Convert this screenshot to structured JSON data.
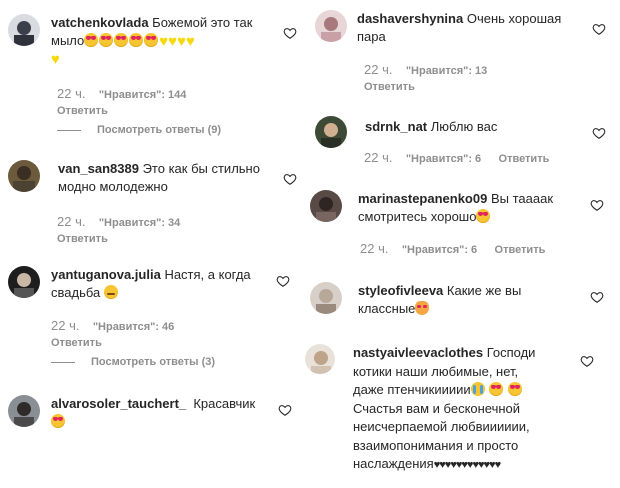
{
  "meta_labels": {
    "likes_label": "\"Нравится\": ",
    "reply_label": "Ответить",
    "view_replies_label": "Посмотреть ответы"
  },
  "comments": {
    "c1": {
      "username": "vatchenkovlada",
      "text": "Божемой это так мыло",
      "time": "22 ч.",
      "likes": "\"Нравится\": 144",
      "reply": "Ответить",
      "view_replies": "Посмотреть ответы (9)"
    },
    "c2": {
      "username": "van_san8389",
      "text": "Это как бы стильно модно молодежно",
      "text_line1": "Это как бы стильно",
      "text_line2": "модно молодежно",
      "time": "22 ч.",
      "likes": "\"Нравится\": 34",
      "reply": "Ответить"
    },
    "c3": {
      "username": "yantuganova.julia",
      "text_line1": "Настя, а когда",
      "text_line2": "свадьба",
      "time": "22 ч.",
      "likes": "\"Нравится\": 46",
      "reply": "Ответить",
      "view_replies": "Посмотреть ответы (3)"
    },
    "c4": {
      "username": "alvarosoler_tauchert_",
      "text": "Красавчик"
    },
    "c5": {
      "username": "dashavershynina",
      "text_line1": "Очень хорошая",
      "text_line2": "пара",
      "time": "22 ч.",
      "likes": "\"Нравится\": 13",
      "reply": "Ответить"
    },
    "c6": {
      "username": "sdrnk_nat",
      "text": "Люблю вас",
      "time": "22 ч.",
      "likes": "\"Нравится\": 6",
      "reply": "Ответить"
    },
    "c7": {
      "username": "marinastepanenko09",
      "text_line1": "Вы таааак",
      "text_line2": "смотритесь хорошо",
      "time": "22 ч.",
      "likes": "\"Нравится\": 6",
      "reply": "Ответить"
    },
    "c8": {
      "username": "styleofivleeva",
      "text_line1": "Какие же вы",
      "text_line2": "классные"
    },
    "c9": {
      "username": "nastyaivleevaclothes",
      "text_line1": "Господи",
      "text_line2": "котики наши любимые, нет,",
      "text_line3": "даже птенчикиииии",
      "text_line4": "Счастья вам и бесконечной",
      "text_line5": "неисчерпаемой любвииииии,",
      "text_line6": "взаимопонимания и просто",
      "text_line7": "наслаждения",
      "hearts": "♥♥♥♥♥♥♥♥♥♥♥♥"
    }
  },
  "icons": {
    "like": "heart-outline-icon",
    "emoji_hearteyes": "smiling-face-with-heart-eyes",
    "emoji_yellow_heart": "yellow-heart",
    "emoji_smirk": "grinning-squinting-face",
    "emoji_cat": "heart-eyes-cat",
    "emoji_cry": "loudly-crying-face"
  },
  "colors": {
    "text": "#262626",
    "secondary": "#8e8e8e",
    "background": "#ffffff"
  }
}
